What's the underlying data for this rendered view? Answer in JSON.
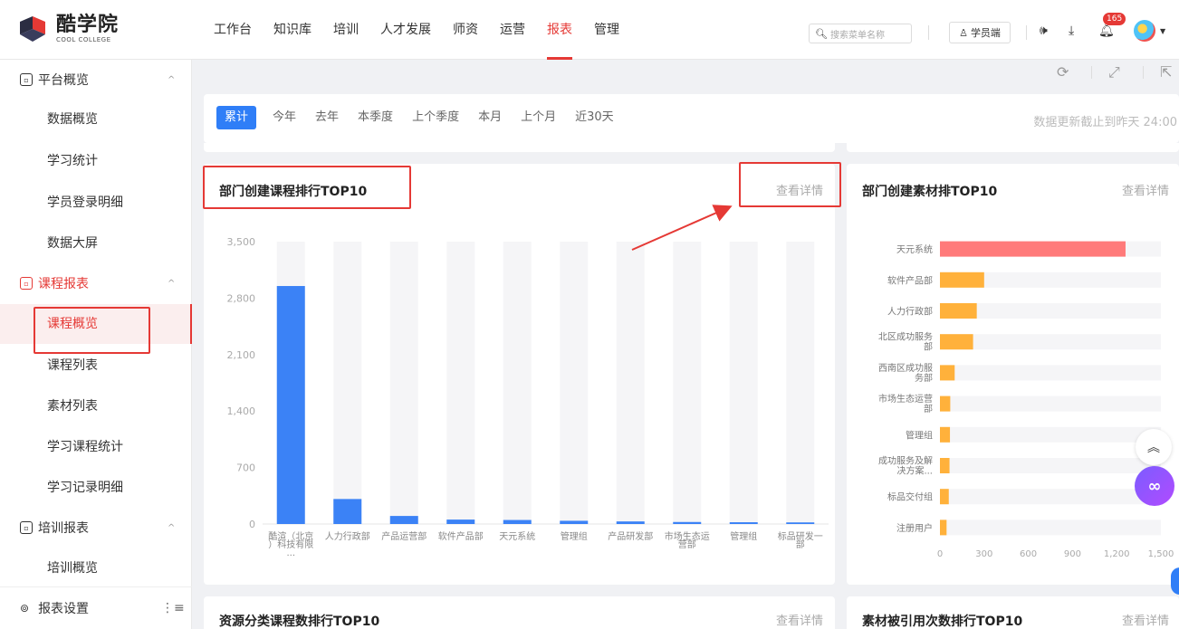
{
  "brand": {
    "name_cn": "酷学院",
    "name_en": "COOL COLLEGE"
  },
  "nav": [
    {
      "label": "工作台"
    },
    {
      "label": "知识库"
    },
    {
      "label": "培训"
    },
    {
      "label": "人才发展"
    },
    {
      "label": "师资"
    },
    {
      "label": "运营"
    },
    {
      "label": "报表",
      "active": true
    },
    {
      "label": "管理"
    }
  ],
  "header": {
    "search_placeholder": "搜索菜单名称",
    "student_button": "学员端",
    "notification_count": "165"
  },
  "sidebar": {
    "groups": [
      {
        "label": "平台概览",
        "items": [
          "数据概览",
          "学习统计",
          "学员登录明细",
          "数据大屏"
        ]
      },
      {
        "label": "课程报表",
        "items": [
          "课程概览",
          "课程列表",
          "素材列表",
          "学习课程统计",
          "学习记录明细"
        ],
        "active_item": "课程概览"
      },
      {
        "label": "培训报表",
        "items": [
          "培训概览"
        ]
      }
    ],
    "footer_label": "报表设置"
  },
  "filters": {
    "options": [
      "累计",
      "今年",
      "去年",
      "本季度",
      "上个季度",
      "本月",
      "上个月",
      "近30天"
    ],
    "active": "累计",
    "update_note": "数据更新截止到昨天 24:00"
  },
  "panels": {
    "dept_courses": {
      "title": "部门创建课程排行TOP10",
      "link": "查看详情"
    },
    "dept_materials": {
      "title": "部门创建素材排TOP10",
      "link": "查看详情"
    },
    "resource_category": {
      "title": "资源分类课程数排行TOP10",
      "link": "查看详情"
    },
    "material_citations": {
      "title": "素材被引用次数排行TOP10",
      "link": "查看详情"
    }
  },
  "chart_data": [
    {
      "type": "bar",
      "categories": [
        "酷渲（北京）科技有限...",
        "人力行政部",
        "产品运营部",
        "软件产品部",
        "天元系统",
        "管理组",
        "产品研发部",
        "市场生态运营部",
        "管理组",
        "标品研发一部"
      ],
      "category_lines": [
        [
          "酷渲（北京",
          "）科技有限",
          "..."
        ],
        [
          "人力行政部"
        ],
        [
          "产品运营部"
        ],
        [
          "软件产品部"
        ],
        [
          "天元系统"
        ],
        [
          "管理组"
        ],
        [
          "产品研发部"
        ],
        [
          "市场生态运",
          "营部"
        ],
        [
          "管理组"
        ],
        [
          "标品研发一",
          "部"
        ]
      ],
      "values": [
        2950,
        310,
        100,
        55,
        50,
        40,
        32,
        25,
        22,
        20
      ],
      "yticks": [
        "0",
        "700",
        "1,400",
        "2,100",
        "2,800",
        "3,500"
      ],
      "ylim": [
        0,
        3500
      ],
      "color": "#3b82f6"
    },
    {
      "type": "bar",
      "orientation": "horizontal",
      "categories": [
        "天元系统",
        "软件产品部",
        "人力行政部",
        "北区成功服务部",
        "西南区成功服务部",
        "市场生态运营部",
        "管理组",
        "成功服务及解决方案...",
        "标品交付组",
        "注册用户"
      ],
      "category_lines": [
        [
          "天元系统"
        ],
        [
          "软件产品部"
        ],
        [
          "人力行政部"
        ],
        [
          "北区成功服务",
          "部"
        ],
        [
          "西南区成功服",
          "务部"
        ],
        [
          "市场生态运营",
          "部"
        ],
        [
          "管理组"
        ],
        [
          "成功服务及解",
          "决方案..."
        ],
        [
          "标品交付组"
        ],
        [
          "注册用户"
        ]
      ],
      "values": [
        1260,
        300,
        250,
        225,
        100,
        70,
        68,
        65,
        60,
        45
      ],
      "xticks": [
        "0",
        "300",
        "600",
        "900",
        "1,200",
        "1,500"
      ],
      "xlim": [
        0,
        1500
      ],
      "colors": {
        "top": "#ff7a7a",
        "rest": "#ffb13b"
      }
    }
  ]
}
